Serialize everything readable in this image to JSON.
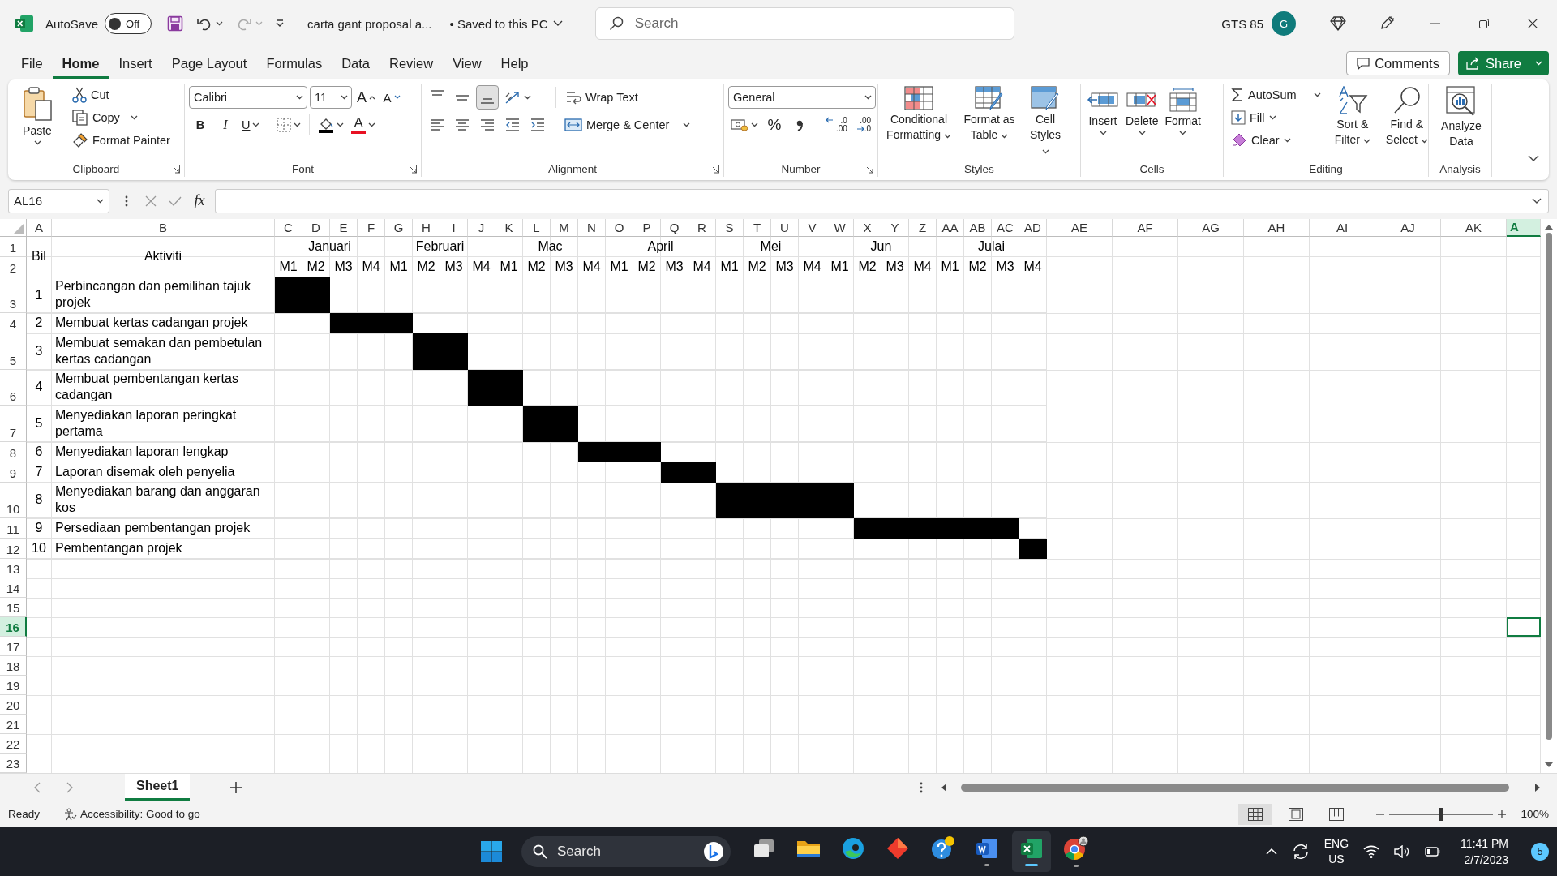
{
  "title_bar": {
    "autosave_label": "AutoSave",
    "autosave_state": "Off",
    "autosave_on": false,
    "document_title": "carta gant proposal a...",
    "save_status": "• Saved to this PC",
    "search_placeholder": "Search",
    "account_name": "GTS 85",
    "avatar_initial": "G"
  },
  "ribbon_tabs": [
    {
      "label": "File",
      "selected": false
    },
    {
      "label": "Home",
      "selected": true
    },
    {
      "label": "Insert",
      "selected": false
    },
    {
      "label": "Page Layout",
      "selected": false
    },
    {
      "label": "Formulas",
      "selected": false
    },
    {
      "label": "Data",
      "selected": false
    },
    {
      "label": "Review",
      "selected": false
    },
    {
      "label": "View",
      "selected": false
    },
    {
      "label": "Help",
      "selected": false
    }
  ],
  "comments_button": "Comments",
  "share_button": "Share",
  "ribbon": {
    "clipboard": {
      "name": "Clipboard",
      "paste": "Paste",
      "cut": "Cut",
      "copy": "Copy",
      "format_painter": "Format Painter"
    },
    "font": {
      "name": "Font",
      "font_name": "Calibri",
      "font_size": "11",
      "grow_font": "A",
      "shrink_font": "A",
      "bold": "B",
      "italic": "I",
      "underline": "U",
      "font_color": "A"
    },
    "alignment": {
      "name": "Alignment",
      "vertical": [
        {
          "selected": false
        },
        {
          "selected": false
        },
        {
          "selected": true
        }
      ],
      "wrap_text": "Wrap Text",
      "merge_center": "Merge & Center"
    },
    "number": {
      "name": "Number",
      "format": "General",
      "percent": "%",
      "increase_decimal": {
        "top": ".0",
        "bottom": ".00"
      },
      "decrease_decimal": {
        "top": ".00",
        "bottom": ".0"
      }
    },
    "styles": {
      "name": "Styles",
      "buttons": [
        "Conditional Formatting",
        "Format as Table",
        "Cell Styles"
      ]
    },
    "cells": {
      "name": "Cells",
      "buttons": [
        "Insert",
        "Delete",
        "Format"
      ]
    },
    "editing": {
      "name": "Editing",
      "autosum": "AutoSum",
      "fill": "Fill",
      "clear": "Clear",
      "sort_filter": "Sort & Filter",
      "find_select": "Find & Select"
    },
    "analysis": {
      "name": "Analysis",
      "analyze_data": "Analyze Data"
    }
  },
  "formula_bar": {
    "name_box": "AL16",
    "fx": "fx"
  },
  "sheet": {
    "column_headers": [
      {
        "label": "A",
        "selected": false
      },
      {
        "label": "B",
        "selected": false
      },
      {
        "label": "C",
        "selected": false
      },
      {
        "label": "D",
        "selected": false
      },
      {
        "label": "E",
        "selected": false
      },
      {
        "label": "F",
        "selected": false
      },
      {
        "label": "G",
        "selected": false
      },
      {
        "label": "H",
        "selected": false
      },
      {
        "label": "I",
        "selected": false
      },
      {
        "label": "J",
        "selected": false
      },
      {
        "label": "K",
        "selected": false
      },
      {
        "label": "L",
        "selected": false
      },
      {
        "label": "M",
        "selected": false
      },
      {
        "label": "N",
        "selected": false
      },
      {
        "label": "O",
        "selected": false
      },
      {
        "label": "P",
        "selected": false
      },
      {
        "label": "Q",
        "selected": false
      },
      {
        "label": "R",
        "selected": false
      },
      {
        "label": "S",
        "selected": false
      },
      {
        "label": "T",
        "selected": false
      },
      {
        "label": "U",
        "selected": false
      },
      {
        "label": "V",
        "selected": false
      },
      {
        "label": "W",
        "selected": false
      },
      {
        "label": "X",
        "selected": false
      },
      {
        "label": "Y",
        "selected": false
      },
      {
        "label": "Z",
        "selected": false
      },
      {
        "label": "AA",
        "selected": false
      },
      {
        "label": "AB",
        "selected": false
      },
      {
        "label": "AC",
        "selected": false
      },
      {
        "label": "AD",
        "selected": false
      },
      {
        "label": "AE",
        "selected": false
      },
      {
        "label": "AF",
        "selected": false
      },
      {
        "label": "AG",
        "selected": false
      },
      {
        "label": "AH",
        "selected": false
      },
      {
        "label": "AI",
        "selected": false
      },
      {
        "label": "AJ",
        "selected": false
      },
      {
        "label": "AK",
        "selected": false
      },
      {
        "label": "A",
        "selected": true
      }
    ],
    "row_headers": [
      {
        "label": "1",
        "selected": false
      },
      {
        "label": "2",
        "selected": false
      },
      {
        "label": "3",
        "selected": false
      },
      {
        "label": "4",
        "selected": false
      },
      {
        "label": "5",
        "selected": false
      },
      {
        "label": "6",
        "selected": false
      },
      {
        "label": "7",
        "selected": false
      },
      {
        "label": "8",
        "selected": false
      },
      {
        "label": "9",
        "selected": false
      },
      {
        "label": "10",
        "selected": false
      },
      {
        "label": "11",
        "selected": false
      },
      {
        "label": "12",
        "selected": false
      },
      {
        "label": "13",
        "selected": false
      },
      {
        "label": "14",
        "selected": false
      },
      {
        "label": "15",
        "selected": false
      },
      {
        "label": "16",
        "selected": true
      },
      {
        "label": "17",
        "selected": false
      },
      {
        "label": "18",
        "selected": false
      },
      {
        "label": "19",
        "selected": false
      },
      {
        "label": "20",
        "selected": false
      },
      {
        "label": "21",
        "selected": false
      },
      {
        "label": "22",
        "selected": false
      },
      {
        "label": "23",
        "selected": false
      }
    ],
    "bil_heading": "Bil",
    "activity_heading": "Aktiviti",
    "months": [
      {
        "label": "Januari",
        "weeks": [
          "M1",
          "M2",
          "M3",
          "M4"
        ]
      },
      {
        "label": "Februari",
        "weeks": [
          "M1",
          "M2",
          "M3",
          "M4"
        ]
      },
      {
        "label": "Mac",
        "weeks": [
          "M1",
          "M2",
          "M3",
          "M4"
        ]
      },
      {
        "label": "April",
        "weeks": [
          "M1",
          "M2",
          "M3",
          "M4"
        ]
      },
      {
        "label": "Mei",
        "weeks": [
          "M1",
          "M2",
          "M3",
          "M4"
        ]
      },
      {
        "label": "Jun",
        "weeks": [
          "M1",
          "M2",
          "M3",
          "M4"
        ]
      },
      {
        "label": "Julai",
        "weeks": [
          "M1",
          "M2",
          "M3",
          "M4"
        ]
      }
    ],
    "rows": [
      {
        "number": "1",
        "activity": "Perbincangan dan pemilihan tajuk projek",
        "weeks": [
          true,
          true,
          false,
          false,
          false,
          false,
          false,
          false,
          false,
          false,
          false,
          false,
          false,
          false,
          false,
          false,
          false,
          false,
          false,
          false,
          false,
          false,
          false,
          false,
          false,
          false,
          false,
          false
        ]
      },
      {
        "number": "2",
        "activity": "Membuat kertas cadangan projek",
        "weeks": [
          false,
          false,
          true,
          true,
          true,
          false,
          false,
          false,
          false,
          false,
          false,
          false,
          false,
          false,
          false,
          false,
          false,
          false,
          false,
          false,
          false,
          false,
          false,
          false,
          false,
          false,
          false,
          false
        ]
      },
      {
        "number": "3",
        "activity": "Membuat semakan dan pembetulan kertas cadangan",
        "weeks": [
          false,
          false,
          false,
          false,
          false,
          true,
          true,
          false,
          false,
          false,
          false,
          false,
          false,
          false,
          false,
          false,
          false,
          false,
          false,
          false,
          false,
          false,
          false,
          false,
          false,
          false,
          false,
          false
        ]
      },
      {
        "number": "4",
        "activity": "Membuat pembentangan kertas cadangan",
        "weeks": [
          false,
          false,
          false,
          false,
          false,
          false,
          false,
          true,
          true,
          false,
          false,
          false,
          false,
          false,
          false,
          false,
          false,
          false,
          false,
          false,
          false,
          false,
          false,
          false,
          false,
          false,
          false,
          false
        ]
      },
      {
        "number": "5",
        "activity": "Menyediakan laporan peringkat pertama",
        "weeks": [
          false,
          false,
          false,
          false,
          false,
          false,
          false,
          false,
          false,
          true,
          true,
          false,
          false,
          false,
          false,
          false,
          false,
          false,
          false,
          false,
          false,
          false,
          false,
          false,
          false,
          false,
          false,
          false
        ]
      },
      {
        "number": "6",
        "activity": "Menyediakan laporan lengkap",
        "weeks": [
          false,
          false,
          false,
          false,
          false,
          false,
          false,
          false,
          false,
          false,
          false,
          true,
          true,
          true,
          false,
          false,
          false,
          false,
          false,
          false,
          false,
          false,
          false,
          false,
          false,
          false,
          false,
          false
        ]
      },
      {
        "number": "7",
        "activity": "Laporan disemak oleh penyelia",
        "weeks": [
          false,
          false,
          false,
          false,
          false,
          false,
          false,
          false,
          false,
          false,
          false,
          false,
          false,
          false,
          true,
          true,
          false,
          false,
          false,
          false,
          false,
          false,
          false,
          false,
          false,
          false,
          false,
          false
        ]
      },
      {
        "number": "8",
        "activity": "Menyediakan barang dan anggaran kos",
        "weeks": [
          false,
          false,
          false,
          false,
          false,
          false,
          false,
          false,
          false,
          false,
          false,
          false,
          false,
          false,
          false,
          false,
          true,
          true,
          true,
          true,
          true,
          false,
          false,
          false,
          false,
          false,
          false,
          false
        ]
      },
      {
        "number": "9",
        "activity": "Persediaan pembentangan projek",
        "weeks": [
          false,
          false,
          false,
          false,
          false,
          false,
          false,
          false,
          false,
          false,
          false,
          false,
          false,
          false,
          false,
          false,
          false,
          false,
          false,
          false,
          false,
          true,
          true,
          true,
          true,
          true,
          true,
          false
        ]
      },
      {
        "number": "10",
        "activity": "Pembentangan projek",
        "weeks": [
          false,
          false,
          false,
          false,
          false,
          false,
          false,
          false,
          false,
          false,
          false,
          false,
          false,
          false,
          false,
          false,
          false,
          false,
          false,
          false,
          false,
          false,
          false,
          false,
          false,
          false,
          false,
          true
        ]
      }
    ]
  },
  "sheet_tabs": [
    {
      "label": "Sheet1",
      "selected": true
    }
  ],
  "status_bar": {
    "status": "Ready",
    "accessibility": "Accessibility: Good to go",
    "views": [
      {
        "selected": true
      },
      {
        "selected": false
      },
      {
        "selected": false
      }
    ],
    "zoom": {
      "level": 0.5
    },
    "zoom_percent": "100%"
  },
  "taskbar": {
    "search_placeholder": "Search",
    "apps": [
      {
        "kind": "taskview",
        "running": false,
        "selected": false
      },
      {
        "kind": "explorer",
        "running": false,
        "selected": false
      },
      {
        "kind": "edge",
        "running": false,
        "selected": false
      },
      {
        "kind": "diamond",
        "running": false,
        "selected": false
      },
      {
        "kind": "tips",
        "running": false,
        "selected": false
      },
      {
        "kind": "word",
        "running": true,
        "selected": false
      },
      {
        "kind": "excel",
        "running": true,
        "selected": true
      },
      {
        "kind": "chrome",
        "running": true,
        "selected": false
      }
    ],
    "language": "ENG",
    "region": "US",
    "time": "11:41 PM",
    "date": "2/7/2023",
    "notifications": "5"
  }
}
